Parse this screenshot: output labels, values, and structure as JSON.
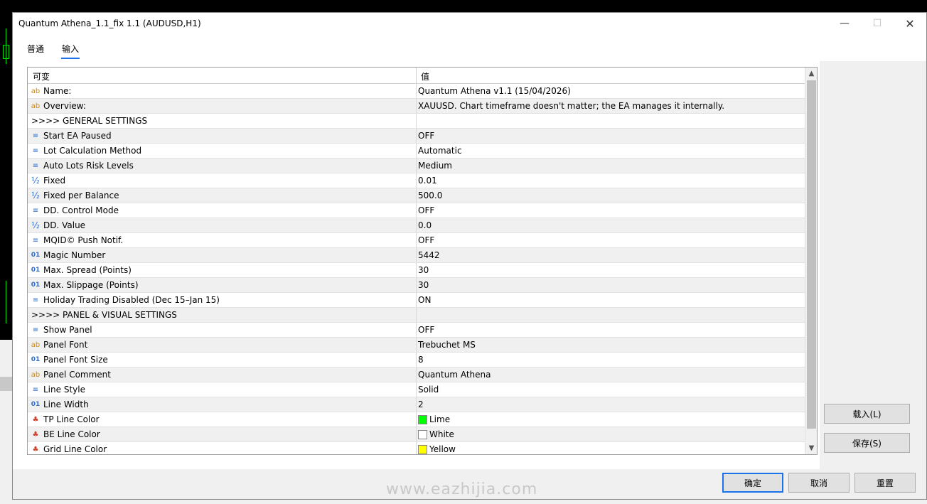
{
  "window": {
    "title": "Quantum Athena_1.1_fix 1.1 (AUDUSD,H1)",
    "minimize": "—",
    "maximize": "☐",
    "close": "✕"
  },
  "tabs": [
    {
      "label": "普通",
      "active": false
    },
    {
      "label": "输入",
      "active": true
    }
  ],
  "grid": {
    "col_variable": "可变",
    "col_value": "值",
    "rows": [
      {
        "icon": "text-icon",
        "glyph": "ab",
        "name": "Name:",
        "value": "Quantum Athena v1.1 (15/04/2026)"
      },
      {
        "icon": "text-icon",
        "glyph": "ab",
        "name": "Overview:",
        "value": "XAUUSD. Chart timeframe doesn't matter; the EA manages it internally."
      },
      {
        "icon": "",
        "glyph": "",
        "name": ">>>> GENERAL SETTINGS",
        "value": "",
        "section": true
      },
      {
        "icon": "enum-icon",
        "glyph": "≡",
        "name": "Start EA Paused",
        "value": "OFF"
      },
      {
        "icon": "enum-icon",
        "glyph": "≡",
        "name": "Lot Calculation Method",
        "value": "Automatic"
      },
      {
        "icon": "enum-icon",
        "glyph": "≡",
        "name": "Auto Lots Risk Levels",
        "value": "Medium"
      },
      {
        "icon": "double-icon",
        "glyph": "½",
        "name": "Fixed",
        "value": "0.01"
      },
      {
        "icon": "double-icon",
        "glyph": "½",
        "name": "Fixed per Balance",
        "value": "500.0"
      },
      {
        "icon": "enum-icon",
        "glyph": "≡",
        "name": "DD. Control Mode",
        "value": "OFF"
      },
      {
        "icon": "double-icon",
        "glyph": "½",
        "name": "DD. Value",
        "value": "0.0"
      },
      {
        "icon": "enum-icon",
        "glyph": "≡",
        "name": "MQID© Push Notif.",
        "value": "OFF"
      },
      {
        "icon": "int-icon",
        "glyph": "01",
        "name": "Magic Number",
        "value": "5442"
      },
      {
        "icon": "int-icon",
        "glyph": "01",
        "name": "Max. Spread (Points)",
        "value": "30"
      },
      {
        "icon": "int-icon",
        "glyph": "01",
        "name": "Max. Slippage (Points)",
        "value": "30"
      },
      {
        "icon": "enum-icon",
        "glyph": "≡",
        "name": "Holiday Trading Disabled (Dec 15–Jan 15)",
        "value": "ON"
      },
      {
        "icon": "",
        "glyph": "",
        "name": ">>>> PANEL & VISUAL SETTINGS",
        "value": "",
        "section": true
      },
      {
        "icon": "enum-icon",
        "glyph": "≡",
        "name": "Show Panel",
        "value": "OFF"
      },
      {
        "icon": "text-icon",
        "glyph": "ab",
        "name": "Panel Font",
        "value": "Trebuchet MS"
      },
      {
        "icon": "int-icon",
        "glyph": "01",
        "name": "Panel Font Size",
        "value": "8"
      },
      {
        "icon": "text-icon",
        "glyph": "ab",
        "name": "Panel Comment",
        "value": "Quantum Athena"
      },
      {
        "icon": "enum-icon",
        "glyph": "≡",
        "name": "Line Style",
        "value": "Solid"
      },
      {
        "icon": "int-icon",
        "glyph": "01",
        "name": "Line Width",
        "value": "2"
      },
      {
        "icon": "color-icon",
        "glyph": "♣",
        "name": "TP Line Color",
        "value": "Lime",
        "swatch": "#00ff00"
      },
      {
        "icon": "color-icon",
        "glyph": "♣",
        "name": "BE Line Color",
        "value": "White",
        "swatch": "#ffffff"
      },
      {
        "icon": "color-icon",
        "glyph": "♣",
        "name": "Grid Line Color",
        "value": "Yellow",
        "swatch": "#ffff00"
      }
    ]
  },
  "buttons": {
    "load": "载入(L)",
    "save": "保存(S)",
    "ok": "确定",
    "cancel": "取消",
    "reset": "重置"
  },
  "watermark": "www.eazhijia.com",
  "colors": {
    "accent": "#1a73e8",
    "chart_candle": "#00e000"
  }
}
